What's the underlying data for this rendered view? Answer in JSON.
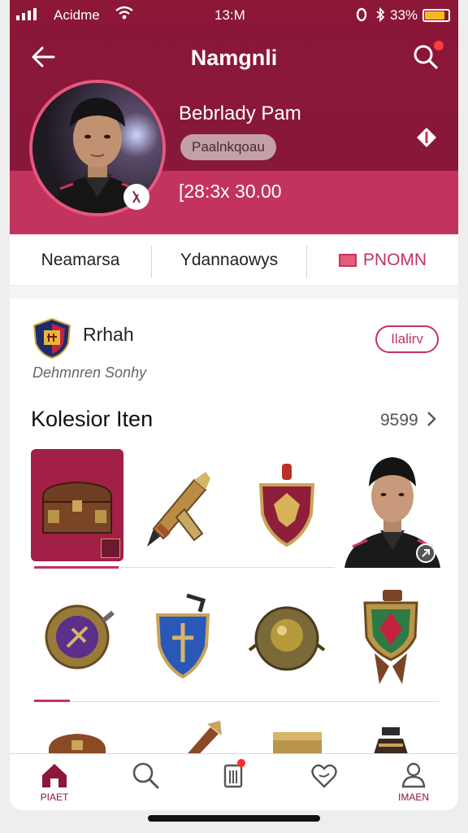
{
  "status_bar": {
    "carrier": "Acidme",
    "time": "13:M",
    "battery_pct": "33%",
    "battery_level": 0.85
  },
  "nav": {
    "title": "Namgnli"
  },
  "profile": {
    "name": "Bebrlady Pam",
    "role": "Paalnkqoau",
    "balance": "[28:3x 30.00"
  },
  "tabs": [
    {
      "label": "Neamarsa"
    },
    {
      "label": "Ydannaowys"
    },
    {
      "label": "PNOMN"
    }
  ],
  "guild": {
    "name": "Rrhah",
    "subtitle": "Dehmnren  Sonhy",
    "button": "Ilalirv"
  },
  "collection": {
    "title": "Kolesior Iten",
    "count": "9599",
    "items": [
      {
        "icon": "treasure-chest-icon"
      },
      {
        "icon": "sword-icon"
      },
      {
        "icon": "shield-icon"
      },
      {
        "icon": "character-portrait"
      },
      {
        "icon": "emblem-badge-icon"
      },
      {
        "icon": "blue-shield-badge-icon"
      },
      {
        "icon": "orb-emblem-icon"
      },
      {
        "icon": "banner-shield-icon"
      },
      {
        "icon": "chest-icon"
      },
      {
        "icon": "horn-icon"
      },
      {
        "icon": "drum-icon"
      },
      {
        "icon": "lamp-icon"
      }
    ]
  },
  "tabbar": {
    "home_label": "PIAET",
    "profile_label": "IMAEN"
  },
  "colors": {
    "brand": "#8c1737",
    "accent": "#c2345d"
  }
}
